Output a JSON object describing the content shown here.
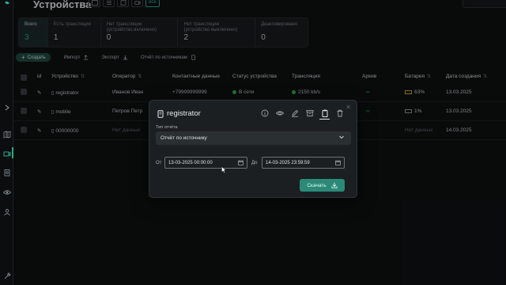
{
  "page": {
    "title": "Устройства"
  },
  "view_toggle": {
    "all_label": "все"
  },
  "stats": [
    {
      "label": "Всего",
      "value": "3"
    },
    {
      "label": "Есть трансляция",
      "value": "1"
    },
    {
      "label": "Нет трансляции (устройство включено)",
      "value": "0"
    },
    {
      "label": "Нет трансляции (устройство выключено)",
      "value": "2"
    },
    {
      "label": "Деактивировано",
      "value": "0"
    }
  ],
  "actions": {
    "create": "Создать",
    "import": "Импорт",
    "export": "Экспорт",
    "report": "Отчёт по источникам"
  },
  "table": {
    "columns": [
      "id",
      "Устройство",
      "Оператор",
      "Контактные данные",
      "Статус устройства",
      "Трансляция",
      "Архив",
      "Батарея",
      "Дата создания"
    ],
    "rows": [
      {
        "device": "registrator",
        "operator": "Иванов Иван",
        "contact": "+79999999999",
        "status": "В сети",
        "stream": "2150 kb/s",
        "battery": "63%",
        "date": "13.03.2025"
      },
      {
        "device": "mobile",
        "operator": "Петров Петр",
        "contact": "",
        "status": "",
        "stream": "",
        "battery": "1%",
        "date": "13.03.2025"
      },
      {
        "device": "00000000",
        "operator": "Нет данных",
        "contact": "",
        "status": "",
        "stream": "",
        "battery": "Нет данных",
        "date": "14.03.2025"
      }
    ]
  },
  "modal": {
    "device_name": "registrator",
    "report_type_label": "Тип отчёта",
    "report_type_value": "Отчёт по источнику",
    "from_label": "От",
    "from_value": "13-03-2025 00:00:00",
    "to_label": "До",
    "to_value": "14-03-2025 23:59:59",
    "download": "Скачать"
  },
  "colors": {
    "accent": "#2aa889",
    "online": "#2bb24c",
    "bg": "#0f1112"
  }
}
